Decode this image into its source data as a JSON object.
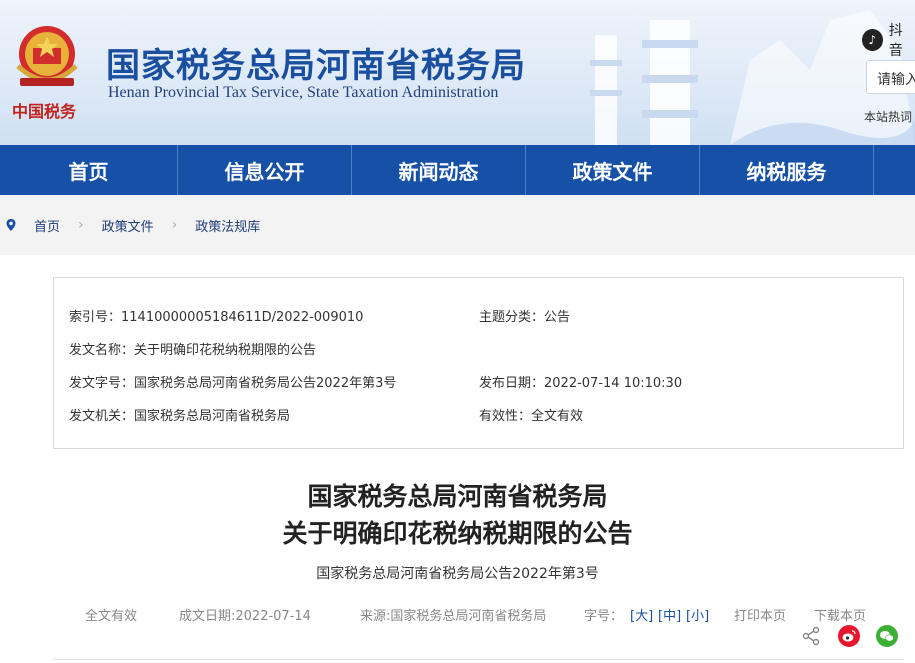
{
  "header": {
    "emblem_text": "中国税务",
    "title": "国家税务总局河南省税务局",
    "subtitle": "Henan Provincial Tax Service, State Taxation Administration",
    "douyin_label": "抖音",
    "search_placeholder": "请输入",
    "hot_words_label": "本站热词"
  },
  "nav": {
    "items": [
      "首页",
      "信息公开",
      "新闻动态",
      "政策文件",
      "纳税服务"
    ]
  },
  "breadcrumb": [
    "首页",
    "政策文件",
    "政策法规库"
  ],
  "meta": {
    "index_label": "索引号：",
    "index_value": "11410000005184611D/2022-009010",
    "topic_label": "主题分类：",
    "topic_value": "公告",
    "doc_name_label": "发文名称：",
    "doc_name_value": "关于明确印花税纳税期限的公告",
    "doc_code_label": "发文字号：",
    "doc_code_value": "国家税务总局河南省税务局公告2022年第3号",
    "pub_date_label": "发布日期：",
    "pub_date_value": "2022-07-14 10:10:30",
    "issuer_label": "发文机关：",
    "issuer_value": "国家税务总局河南省税务局",
    "validity_label": "有效性：",
    "validity_value": "全文有效"
  },
  "document": {
    "title_line1": "国家税务总局河南省税务局",
    "title_line2": "关于明确印花税纳税期限的公告",
    "number": "国家税务总局河南省税务局公告2022年第3号"
  },
  "info_bar": {
    "validity": "全文有效",
    "date": "成文日期:2022-07-14",
    "source": "来源:国家税务总局河南省税务局",
    "font_label": "字号：",
    "size_large": "[大]",
    "size_medium": "[中]",
    "size_small": "[小]",
    "print": "打印本页",
    "download": "下载本页"
  },
  "colors": {
    "nav_bg": "#1750a7",
    "title_blue": "#1a4fa0",
    "weibo_red": "#e6162d",
    "wechat_green": "#3cb034"
  },
  "icons": [
    "location-icon",
    "share-icon",
    "weibo-icon",
    "wechat-icon",
    "douyin-icon",
    "emblem-icon"
  ]
}
